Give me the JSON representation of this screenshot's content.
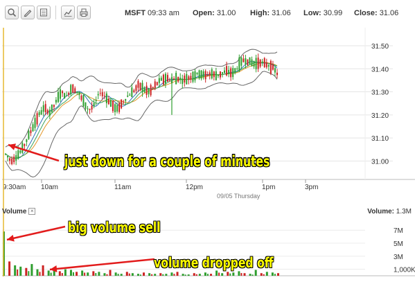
{
  "toolbar": {
    "buttons": [
      {
        "icon": "zoom-icon"
      },
      {
        "icon": "pencil-icon"
      },
      {
        "icon": "page-icon"
      },
      {
        "icon": "chart-icon"
      },
      {
        "icon": "printer-icon"
      }
    ]
  },
  "quote": {
    "symbol": "MSFT",
    "time": "09:33 am",
    "open_label": "Open:",
    "open_value": "31.00",
    "high_label": "High:",
    "high_value": "31.06",
    "low_label": "Low:",
    "low_value": "30.99",
    "close_label": "Close:",
    "close_value": "31.06"
  },
  "volume_panel": {
    "tab_label": "Volume",
    "total_label": "Volume:",
    "total_value": "1.3M"
  },
  "annotations": {
    "a1": "just down for a couple of minutes",
    "a2": "big volume sell",
    "a3": "volume dropped off"
  },
  "chart_data": {
    "type": "candlestick",
    "price_ticks": [
      "31.50",
      "31.40",
      "31.30",
      "31.20",
      "31.10",
      "31.00"
    ],
    "price_tick_values": [
      31.5,
      31.4,
      31.3,
      31.2,
      31.1,
      31.0
    ],
    "ylim": [
      30.92,
      31.56
    ],
    "time_labels": [
      "9:30am",
      "10am",
      "11am",
      "12pm",
      "1pm",
      "3pm"
    ],
    "date_label": "09/05 Thursday",
    "volume_ticks": [
      "7M",
      "5M",
      "3M",
      "1,000K"
    ],
    "volume_tick_values": [
      7,
      5,
      3,
      1
    ],
    "volume_ylim": [
      0,
      8.3
    ],
    "overlay": "Bollinger Bands with moving averages",
    "colors": {
      "up": "#2e9e2e",
      "down": "#cc2222",
      "band": "#666666",
      "annotation_text": "#ffff00",
      "arrow": "#e21b1b",
      "vline": "#e6b830"
    },
    "price_path": [
      31.03,
      31.0,
      31.02,
      31.05,
      31.1,
      31.15,
      31.2,
      31.23,
      31.21,
      31.25,
      31.3,
      31.28,
      31.32,
      31.3,
      31.26,
      31.22,
      31.24,
      31.3,
      31.28,
      31.25,
      31.22,
      31.25,
      31.28,
      31.3,
      31.33,
      31.31,
      31.3,
      31.33,
      31.35,
      31.36,
      31.35,
      31.36,
      31.35,
      31.36,
      31.37,
      31.38,
      31.37,
      31.38,
      31.37,
      31.38,
      31.39,
      31.38,
      31.41,
      31.44,
      31.43,
      31.42,
      31.43,
      31.42,
      31.41,
      31.38
    ],
    "volume_path": [
      6.8,
      2.2,
      1.6,
      1.4,
      1.2,
      1.8,
      1.0,
      1.6,
      0.8,
      1.1,
      0.7,
      1.0,
      0.9,
      0.6,
      0.8,
      0.5,
      0.7,
      0.6,
      0.4,
      0.9,
      0.5,
      0.3,
      0.6,
      0.4,
      0.3,
      0.5,
      0.4,
      0.3,
      0.4,
      0.3,
      0.5,
      0.6,
      0.3,
      0.2,
      0.4,
      0.3,
      0.5,
      0.3,
      0.8,
      0.4,
      0.6,
      0.5,
      0.7,
      0.4,
      0.3,
      0.9,
      0.4,
      0.6,
      0.5,
      0.4
    ]
  }
}
